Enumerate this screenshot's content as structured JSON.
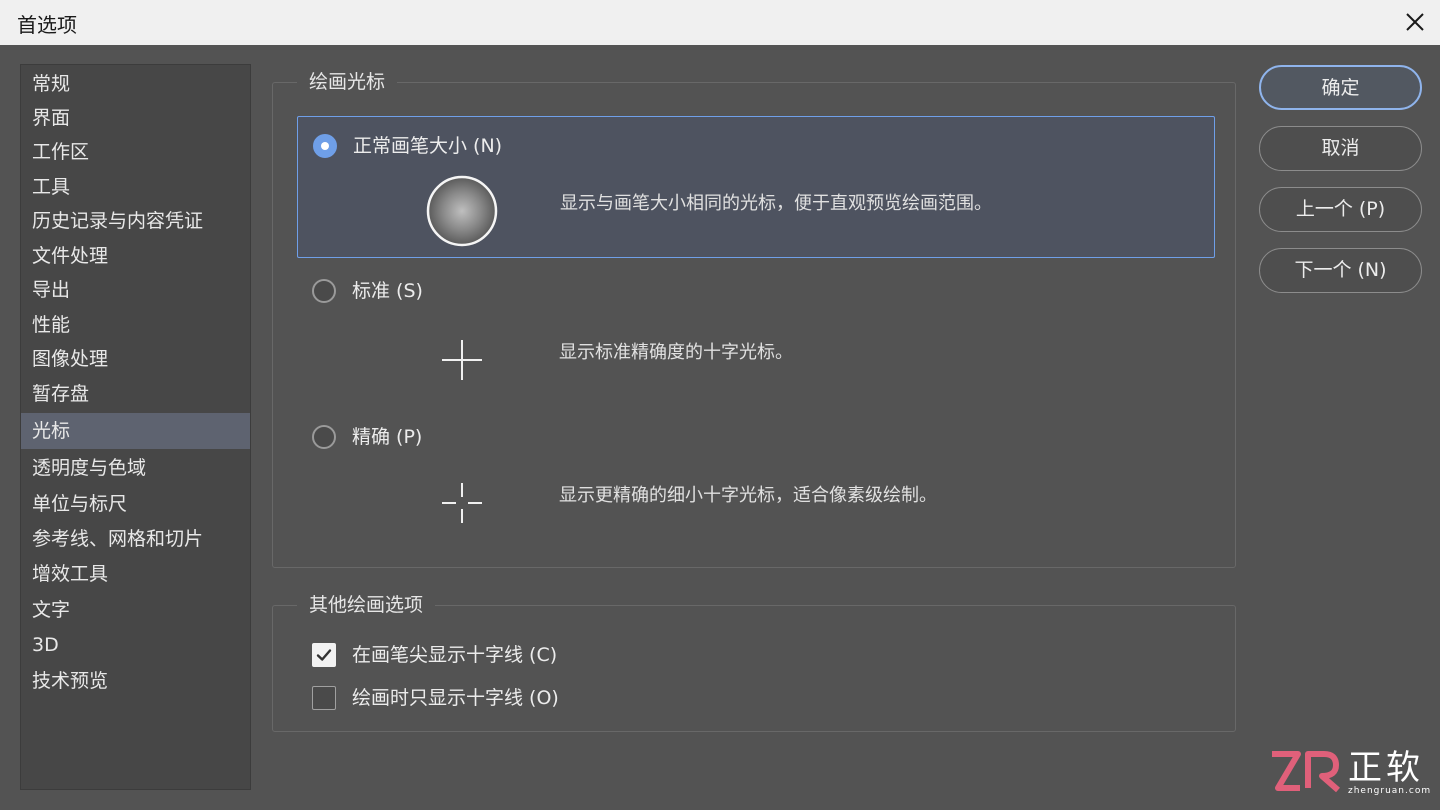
{
  "window": {
    "title": "首选项"
  },
  "sidebar": {
    "items": [
      {
        "label": "常规"
      },
      {
        "label": "界面"
      },
      {
        "label": "工作区"
      },
      {
        "label": "工具"
      },
      {
        "label": "历史记录与内容凭证"
      },
      {
        "label": "文件处理"
      },
      {
        "label": "导出"
      },
      {
        "label": "性能"
      },
      {
        "label": "图像处理"
      },
      {
        "label": "暂存盘"
      },
      {
        "label": "光标"
      },
      {
        "label": "透明度与色域"
      },
      {
        "label": "单位与标尺"
      },
      {
        "label": "参考线、网格和切片"
      },
      {
        "label": "增效工具"
      },
      {
        "label": "文字"
      },
      {
        "label": "3D"
      },
      {
        "label": "技术预览"
      }
    ],
    "active_index": 10
  },
  "painting_cursors": {
    "legend": "绘画光标",
    "options": [
      {
        "label": "正常画笔大小 (N)",
        "description": "显示与画笔大小相同的光标，便于直观预览绘画范围。",
        "checked": true,
        "preview_icon": "brush-circle-icon"
      },
      {
        "label": "标准 (S)",
        "description": "显示标准精确度的十字光标。",
        "checked": false,
        "preview_icon": "crosshair-icon"
      },
      {
        "label": "精确 (P)",
        "description": "显示更精确的细小十字光标，适合像素级绘制。",
        "checked": false,
        "preview_icon": "precise-crosshair-icon"
      }
    ]
  },
  "other_options": {
    "legend": "其他绘画选项",
    "checkboxes": [
      {
        "label": "在画笔尖显示十字线 (C)",
        "checked": true
      },
      {
        "label": "绘画时只显示十字线 (O)",
        "checked": false
      }
    ]
  },
  "buttons": {
    "ok": "确定",
    "cancel": "取消",
    "prev": "上一个 (P)",
    "next": "下一个 (N)"
  },
  "watermark": {
    "cn": "正软",
    "url": "zhengruan.com"
  },
  "colors": {
    "accent": "#6f9fe8",
    "background": "#535353",
    "sidebar": "#474747",
    "selected_row": "#5e6370"
  }
}
